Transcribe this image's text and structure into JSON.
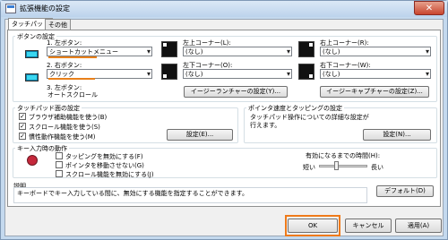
{
  "window": {
    "title": "拡張機能の設定",
    "close": "✕"
  },
  "tabs": [
    "タッチパッド",
    "その他"
  ],
  "buttons_group": {
    "label": "ボタンの設定",
    "left": {
      "label": "1. 左ボタン:",
      "value": "ショートカットメニュー"
    },
    "right": {
      "label": "2. 右ボタン:",
      "value": "クリック"
    },
    "middle": {
      "label": "3. 左ボタン:",
      "value": "オートスクロール"
    },
    "top_left": {
      "label": "左上コーナー(L):",
      "value": "(なし)"
    },
    "bottom_left": {
      "label": "左下コーナー(O):",
      "value": "(なし)"
    },
    "top_right": {
      "label": "右上コーナー(R):",
      "value": "(なし)"
    },
    "bottom_right": {
      "label": "右下コーナー(W):",
      "value": "(なし)"
    },
    "easy_launcher": "イージーランチャーの設定(Y)...",
    "easy_capture": "イージーキャプチャーの設定(Z)..."
  },
  "pad_group": {
    "label": "タッチパッド面の設定",
    "items": [
      {
        "text": "ブラウザ補助機能を使う(B)",
        "checked": true
      },
      {
        "text": "スクロール機能を使う(S)",
        "checked": true
      },
      {
        "text": "慣性動作機能を使う(M)",
        "checked": true
      }
    ],
    "settings": "設定(E)..."
  },
  "speed_group": {
    "label": "ポインタ速度とタッピングの設定",
    "desc1": "タッチパッド操作についての詳細な設定が",
    "desc2": "行えます。",
    "settings": "設定(N)..."
  },
  "key_group": {
    "label": "キー入力時の動作",
    "items": [
      {
        "text": "タッピングを無効にする(F)",
        "checked": false
      },
      {
        "text": "ポインタを移動させない(G)",
        "checked": false
      },
      {
        "text": "スクロール機能を無効にする(J)",
        "checked": false
      }
    ],
    "time_label": "有効になるまでの時間(H):",
    "short": "短い",
    "long": "長い",
    "slider_level": 0.35
  },
  "help": {
    "label": "説明",
    "text": "キーボードでキー入力している間に、無効にする機能を指定することができます。",
    "default": "デフォルト(D)"
  },
  "footer": {
    "ok": "OK",
    "cancel": "キャンセル",
    "apply": "適用(A)"
  }
}
